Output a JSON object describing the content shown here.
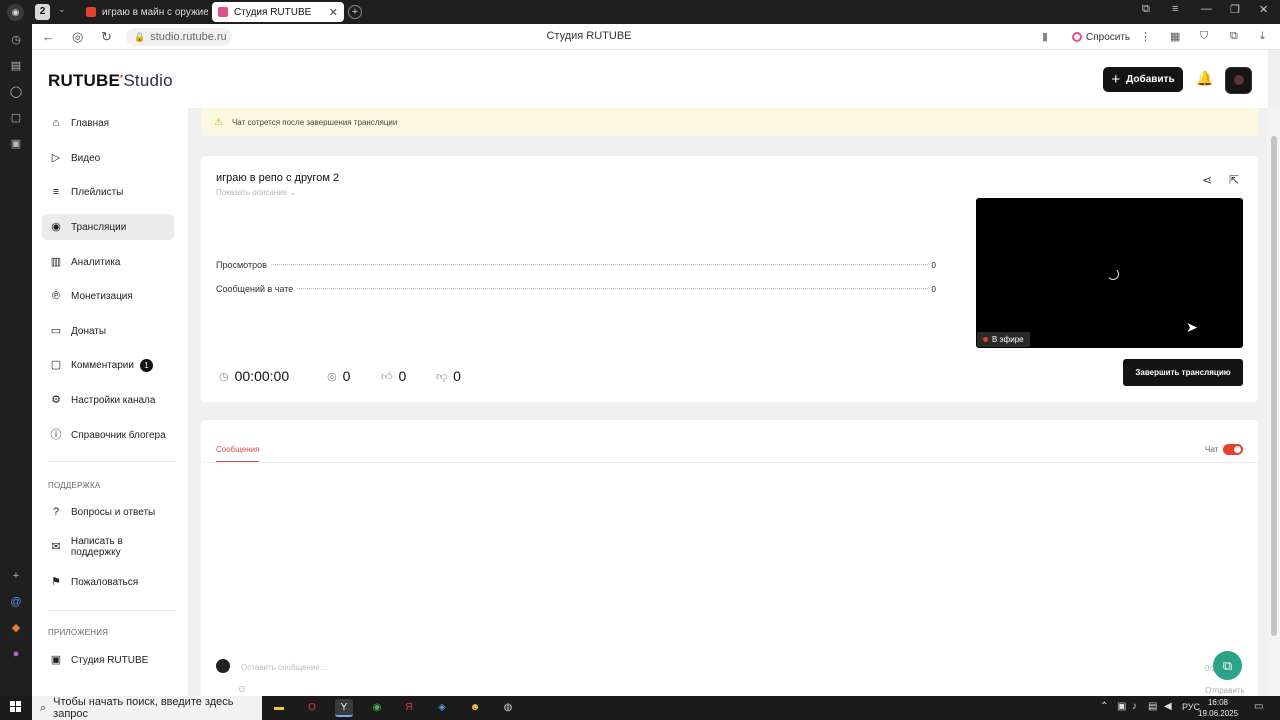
{
  "browser": {
    "workspace_badge": "2",
    "tabs": [
      {
        "label": "играю в майн с оружием",
        "color": "#e4402a",
        "active": false
      },
      {
        "label": "Студия RUTUBE",
        "color": "#e0508a",
        "active": true
      }
    ],
    "url": "studio.rutube.ru",
    "page_title": "Студия RUTUBE",
    "ask_label": "Спросить"
  },
  "header": {
    "logo_main": "RUTUBE",
    "logo_studio": "Studio",
    "add_button": "Добавить"
  },
  "sidebar": {
    "items": [
      {
        "label": "Главная",
        "icon": "home-icon",
        "glyph": "⌂"
      },
      {
        "label": "Видео",
        "icon": "video-icon",
        "glyph": "▷"
      },
      {
        "label": "Плейлисты",
        "icon": "playlist-icon",
        "glyph": "≡"
      },
      {
        "label": "Трансляции",
        "icon": "broadcast-icon",
        "glyph": "◉"
      },
      {
        "label": "Аналитика",
        "icon": "analytics-icon",
        "glyph": "▥"
      },
      {
        "label": "Монетизация",
        "icon": "monetization-icon",
        "glyph": "℗"
      },
      {
        "label": "Донаты",
        "icon": "donate-icon",
        "glyph": "▭"
      },
      {
        "label": "Комментарии",
        "icon": "comments-icon",
        "glyph": "▢",
        "count": "1"
      },
      {
        "label": "Настройки канала",
        "icon": "settings-icon",
        "glyph": "⚙"
      },
      {
        "label": "Справочник блогера",
        "icon": "info-icon",
        "glyph": "ⓘ"
      }
    ],
    "support_heading": "ПОДДЕРЖКА",
    "support_items": [
      {
        "label": "Вопросы и ответы",
        "icon": "help-icon",
        "glyph": "?"
      },
      {
        "label": "Написать в поддержку",
        "icon": "mail-icon",
        "glyph": "✉"
      },
      {
        "label": "Пожаловаться",
        "icon": "flag-icon",
        "glyph": "⚑"
      }
    ],
    "apps_heading": "ПРИЛОЖЕНИЯ",
    "apps_items": [
      {
        "label": "Студия RUTUBE",
        "icon": "app-icon",
        "glyph": "▣"
      }
    ]
  },
  "warning": {
    "text": "Чат сотрется после завершения трансляции"
  },
  "stream": {
    "title": "играю в репо с другом 2",
    "show_description": "Показать описание",
    "stats": [
      {
        "label": "Просмотров",
        "value": "0"
      },
      {
        "label": "Сообщений в чате",
        "value": "0"
      }
    ],
    "live_label": "В эфире",
    "timer": "00:00:00",
    "viewers": "0",
    "likes": "0",
    "dislikes": "0",
    "end_button": "Завершить трансляцию"
  },
  "chat": {
    "tab_label": "Сообщения",
    "toggle_label": "Чат",
    "toggle_on": true,
    "input_placeholder": "Оставить сообщение...",
    "char_count": "0/2",
    "send_label": "Отправить"
  },
  "taskbar": {
    "search_placeholder": "Чтобы начать поиск, введите здесь запрос",
    "lang": "РУС",
    "time": "16:08",
    "date": "19.06.2025"
  }
}
